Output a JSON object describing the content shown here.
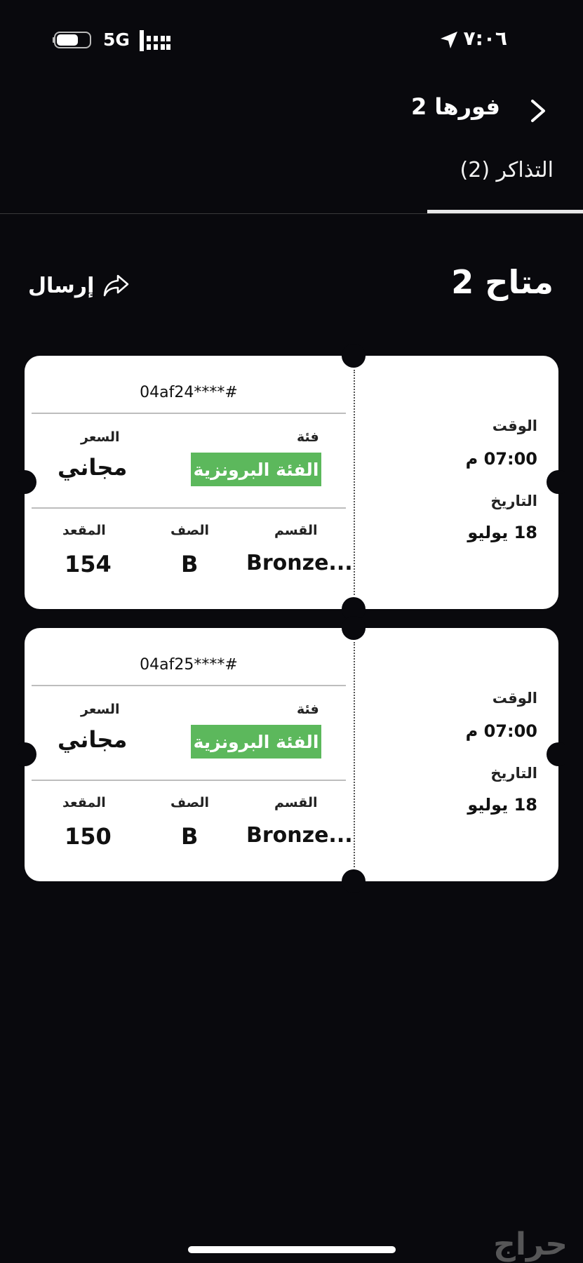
{
  "status_bar": {
    "time": "٧:٠٦",
    "network": "5G"
  },
  "header": {
    "event_title": "فورها 2",
    "tab_label": "التذاكر (2)"
  },
  "section": {
    "available_label": "متاح 2",
    "send_label": "إرسال"
  },
  "labels": {
    "category": "فئة",
    "price": "السعر",
    "section": "القسم",
    "row": "الصف",
    "seat": "المقعد",
    "time": "الوقت",
    "date": "التاريخ"
  },
  "tickets": [
    {
      "code": "04af24****#",
      "category_value": "الفئة البرونزية",
      "price_value": "مجاني",
      "section_value": "Bronze...",
      "row_value": "B",
      "seat_value": "154",
      "time_value": "07:00 م",
      "date_value": "18 يوليو"
    },
    {
      "code": "04af25****#",
      "category_value": "الفئة البرونزية",
      "price_value": "مجاني",
      "section_value": "Bronze...",
      "row_value": "B",
      "seat_value": "150",
      "time_value": "07:00 م",
      "date_value": "18 يوليو"
    }
  ],
  "watermark": "حراج",
  "colors": {
    "background": "#09090d",
    "ticket": "#ffffff",
    "category_badge": "#5cb85c"
  }
}
